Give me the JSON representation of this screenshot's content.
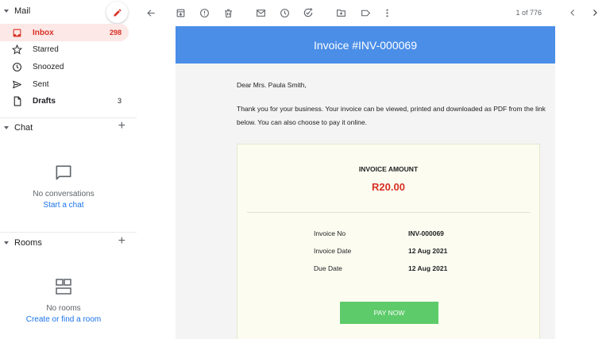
{
  "sidebar": {
    "mail_section": "Mail",
    "items": [
      {
        "label": "Inbox",
        "count": "298",
        "icon": "inbox-icon"
      },
      {
        "label": "Starred",
        "count": "",
        "icon": "star-icon"
      },
      {
        "label": "Snoozed",
        "count": "",
        "icon": "clock-icon"
      },
      {
        "label": "Sent",
        "count": "",
        "icon": "send-icon"
      },
      {
        "label": "Drafts",
        "count": "3",
        "icon": "draft-icon"
      }
    ],
    "chat": {
      "title": "Chat",
      "empty_text": "No conversations",
      "action": "Start a chat"
    },
    "rooms": {
      "title": "Rooms",
      "empty_text": "No rooms",
      "action": "Create or find a room"
    }
  },
  "toolbar": {
    "pager": "1 of 776"
  },
  "email": {
    "banner_title": "Invoice #INV-000069",
    "greeting": "Dear Mrs. Paula Smith,",
    "message": "Thank you for your business. Your invoice can be viewed, printed and downloaded as PDF from the link below. You can also choose to pay it online.",
    "amount_label": "INVOICE AMOUNT",
    "amount": "R20.00",
    "details": [
      {
        "label": "Invoice No",
        "value": "INV-000069"
      },
      {
        "label": "Invoice Date",
        "value": "12 Aug 2021"
      },
      {
        "label": "Due Date",
        "value": "12 Aug 2021"
      }
    ],
    "pay_button": "PAY NOW"
  },
  "colors": {
    "accent_red": "#d93025",
    "banner_blue": "#4a8ee8",
    "pay_green": "#5dcb6a",
    "link_blue": "#1a73e8"
  }
}
